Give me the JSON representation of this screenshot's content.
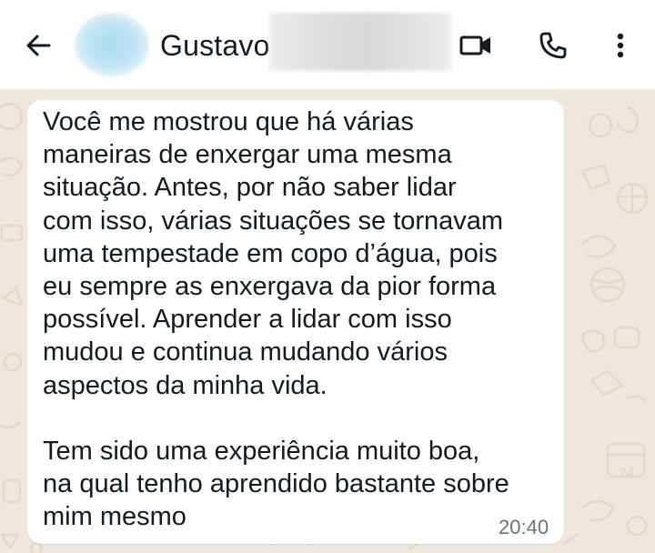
{
  "header": {
    "contact_name": "Gustavo",
    "icons": {
      "back": "arrow-back-icon",
      "video": "video-camera-icon",
      "call": "phone-icon",
      "menu": "more-vertical-icon"
    }
  },
  "message": {
    "text": "Você me mostrou que há várias\nmaneiras de enxergar uma mesma\nsituação. Antes, por não saber lidar\ncom isso, várias situações se tornavam\numa tempestade em copo d’água, pois\neu sempre as enxergava da pior forma\npossível. Aprender a lidar com isso\nmudou e continua mudando vários\naspectos da minha vida.\n\nTem sido uma experiência muito boa,\nna qual tenho aprendido bastante sobre\nmim mesmo",
    "time": "20:40"
  },
  "colors": {
    "header_bg": "#ffffff",
    "chat_bg": "#efe7de",
    "bubble_bg": "#ffffff",
    "text": "#111b21",
    "timestamp": "#667781"
  }
}
